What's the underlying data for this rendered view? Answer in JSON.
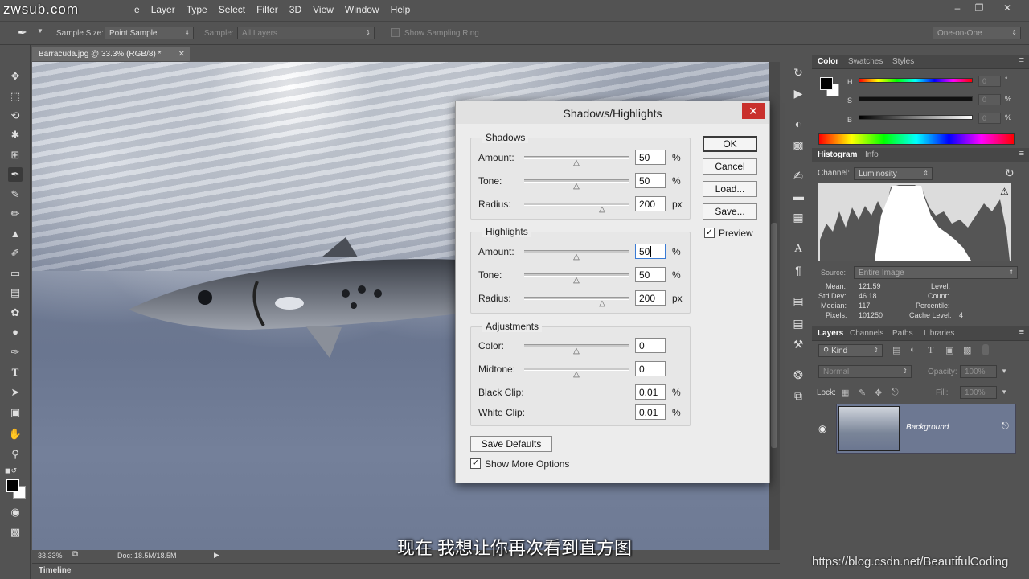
{
  "menubar": {
    "logo": "zwsub.com",
    "items": [
      "e",
      "Layer",
      "Type",
      "Select",
      "Filter",
      "3D",
      "View",
      "Window",
      "Help"
    ]
  },
  "options": {
    "sample_size_label": "Sample Size:",
    "sample_size_value": "Point Sample",
    "sample_label": "Sample:",
    "sample_value": "All Layers",
    "show_ring_label": "Show Sampling Ring",
    "workspace": "One-on-One"
  },
  "document": {
    "tab_title": "Barracuda.jpg @ 33.3% (RGB/8) *",
    "zoom": "33.33%",
    "doc_size": "Doc: 18.5M/18.5M",
    "timeline_label": "Timeline"
  },
  "dialog": {
    "title": "Shadows/Highlights",
    "shadows": {
      "title": "Shadows",
      "amount_label": "Amount:",
      "amount": "50",
      "amount_unit": "%",
      "tone_label": "Tone:",
      "tone": "50",
      "tone_unit": "%",
      "radius_label": "Radius:",
      "radius": "200",
      "radius_unit": "px"
    },
    "highlights": {
      "title": "Highlights",
      "amount_label": "Amount:",
      "amount": "50",
      "amount_unit": "%",
      "tone_label": "Tone:",
      "tone": "50",
      "tone_unit": "%",
      "radius_label": "Radius:",
      "radius": "200",
      "radius_unit": "px"
    },
    "adjustments": {
      "title": "Adjustments",
      "color_label": "Color:",
      "color": "0",
      "midtone_label": "Midtone:",
      "midtone": "0",
      "black_clip_label": "Black Clip:",
      "black_clip": "0.01",
      "black_clip_unit": "%",
      "white_clip_label": "White Clip:",
      "white_clip": "0.01",
      "white_clip_unit": "%"
    },
    "buttons": {
      "ok": "OK",
      "cancel": "Cancel",
      "load": "Load...",
      "save": "Save...",
      "save_defaults": "Save Defaults"
    },
    "preview_label": "Preview",
    "show_more_label": "Show More Options"
  },
  "color_panel": {
    "tabs": [
      "Color",
      "Swatches",
      "Styles"
    ],
    "h_label": "H",
    "s_label": "S",
    "b_label": "B",
    "h_value": "0",
    "s_value": "0",
    "b_value": "0",
    "h_unit": "°",
    "s_unit": "%",
    "b_unit": "%"
  },
  "histogram": {
    "tabs": [
      "Histogram",
      "Info"
    ],
    "channel_label": "Channel:",
    "channel_value": "Luminosity",
    "source_label": "Source:",
    "source_value": "Entire Image",
    "mean_label": "Mean:",
    "mean": "121.59",
    "stddev_label": "Std Dev:",
    "stddev": "46.18",
    "median_label": "Median:",
    "median": "117",
    "pixels_label": "Pixels:",
    "pixels": "101250",
    "level_label": "Level:",
    "count_label": "Count:",
    "percentile_label": "Percentile:",
    "cache_label": "Cache Level:",
    "cache": "4"
  },
  "layers": {
    "tabs": [
      "Layers",
      "Channels",
      "Paths",
      "Libraries"
    ],
    "kind_label": "Kind",
    "blend_mode": "Normal",
    "opacity_label": "Opacity:",
    "opacity": "100%",
    "lock_label": "Lock:",
    "fill_label": "Fill:",
    "fill": "100%",
    "layer_name": "Background"
  },
  "subtitle": "现在 我想让你再次看到直方图",
  "watermark": "https://blog.csdn.net/BeautifulCoding"
}
